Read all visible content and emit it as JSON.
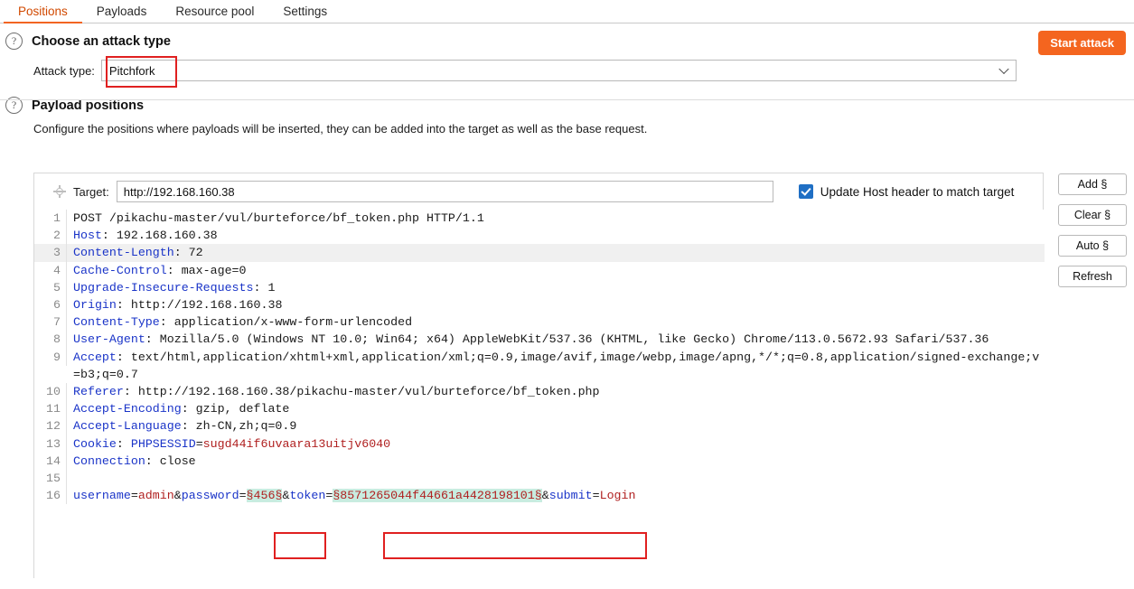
{
  "tabs": [
    {
      "label": "Positions",
      "active": true
    },
    {
      "label": "Payloads",
      "active": false
    },
    {
      "label": "Resource pool",
      "active": false
    },
    {
      "label": "Settings",
      "active": false
    }
  ],
  "start_attack_label": "Start attack",
  "attack_type_section": {
    "title": "Choose an attack type",
    "field_label": "Attack type:",
    "selected": "Pitchfork",
    "help_icon": "question-mark-icon"
  },
  "payload_positions_section": {
    "title": "Payload positions",
    "description": "Configure the positions where payloads will be inserted, they can be added into the target as well as the base request.",
    "help_icon": "question-mark-icon"
  },
  "target": {
    "icon": "crosshair-icon",
    "label": "Target:",
    "value": "http://192.168.160.38",
    "placeholder": "",
    "update_host_checkbox": {
      "label": "Update Host header to match target",
      "checked": true
    }
  },
  "side_buttons": [
    {
      "label": "Add §"
    },
    {
      "label": "Clear §"
    },
    {
      "label": "Auto §"
    },
    {
      "label": "Refresh"
    }
  ],
  "request": {
    "lines": [
      {
        "num": "1",
        "highlight": false,
        "parts": [
          {
            "text": "POST /pikachu-master/vul/burteforce/bf_token.php HTTP/1.1",
            "style": "val"
          }
        ]
      },
      {
        "num": "2",
        "highlight": false,
        "parts": [
          {
            "text": "Host",
            "style": "hdr"
          },
          {
            "text": ": 192.168.160.38",
            "style": "val"
          }
        ]
      },
      {
        "num": "3",
        "highlight": true,
        "parts": [
          {
            "text": "Content-Length",
            "style": "hdr"
          },
          {
            "text": ": 72",
            "style": "val"
          }
        ]
      },
      {
        "num": "4",
        "highlight": false,
        "parts": [
          {
            "text": "Cache-Control",
            "style": "hdr"
          },
          {
            "text": ": max-age=0",
            "style": "val"
          }
        ]
      },
      {
        "num": "5",
        "highlight": false,
        "parts": [
          {
            "text": "Upgrade-Insecure-Requests",
            "style": "hdr"
          },
          {
            "text": ": 1",
            "style": "val"
          }
        ]
      },
      {
        "num": "6",
        "highlight": false,
        "parts": [
          {
            "text": "Origin",
            "style": "hdr"
          },
          {
            "text": ": http://192.168.160.38",
            "style": "val"
          }
        ]
      },
      {
        "num": "7",
        "highlight": false,
        "parts": [
          {
            "text": "Content-Type",
            "style": "hdr"
          },
          {
            "text": ": application/x-www-form-urlencoded",
            "style": "val"
          }
        ]
      },
      {
        "num": "8",
        "highlight": false,
        "parts": [
          {
            "text": "User-Agent",
            "style": "hdr"
          },
          {
            "text": ": Mozilla/5.0 (Windows NT 10.0; Win64; x64) AppleWebKit/537.36 (KHTML, like Gecko) Chrome/113.0.5672.93 Safari/537.36",
            "style": "val"
          }
        ]
      },
      {
        "num": "9",
        "highlight": false,
        "parts": [
          {
            "text": "Accept",
            "style": "hdr"
          },
          {
            "text": ": text/html,application/xhtml+xml,application/xml;q=0.9,image/avif,image/webp,image/apng,*/*;q=0.8,application/signed-exchange;v=b3;q=0.7",
            "style": "val"
          }
        ]
      },
      {
        "num": "10",
        "highlight": false,
        "parts": [
          {
            "text": "Referer",
            "style": "hdr"
          },
          {
            "text": ": http://192.168.160.38/pikachu-master/vul/burteforce/bf_token.php",
            "style": "val"
          }
        ]
      },
      {
        "num": "11",
        "highlight": false,
        "parts": [
          {
            "text": "Accept-Encoding",
            "style": "hdr"
          },
          {
            "text": ": gzip, deflate",
            "style": "val"
          }
        ]
      },
      {
        "num": "12",
        "highlight": false,
        "parts": [
          {
            "text": "Accept-Language",
            "style": "hdr"
          },
          {
            "text": ": zh-CN,zh;q=0.9",
            "style": "val"
          }
        ]
      },
      {
        "num": "13",
        "highlight": false,
        "parts": [
          {
            "text": "Cookie",
            "style": "hdr"
          },
          {
            "text": ": ",
            "style": "val"
          },
          {
            "text": "PHPSESSID",
            "style": "blue"
          },
          {
            "text": "=",
            "style": "val"
          },
          {
            "text": "sugd44if6uvaara13uitjv6040",
            "style": "red"
          }
        ]
      },
      {
        "num": "14",
        "highlight": false,
        "parts": [
          {
            "text": "Connection",
            "style": "hdr"
          },
          {
            "text": ": close",
            "style": "val"
          }
        ]
      },
      {
        "num": "15",
        "highlight": false,
        "parts": [
          {
            "text": "",
            "style": "val"
          }
        ]
      },
      {
        "num": "16",
        "highlight": false,
        "parts": [
          {
            "text": "username",
            "style": "blue"
          },
          {
            "text": "=",
            "style": "val"
          },
          {
            "text": "admin",
            "style": "red"
          },
          {
            "text": "&",
            "style": "val"
          },
          {
            "text": "password",
            "style": "blue"
          },
          {
            "text": "=",
            "style": "val"
          },
          {
            "text": "§456§",
            "style": "mark"
          },
          {
            "text": "&",
            "style": "val"
          },
          {
            "text": "token",
            "style": "blue"
          },
          {
            "text": "=",
            "style": "val"
          },
          {
            "text": "§8571265044f44661a4428198101§",
            "style": "mark"
          },
          {
            "text": "&",
            "style": "val"
          },
          {
            "text": "submit",
            "style": "blue"
          },
          {
            "text": "=",
            "style": "val"
          },
          {
            "text": "Login",
            "style": "red"
          }
        ]
      }
    ]
  },
  "highlight_boxes": [
    {
      "name": "attack-type-highlight"
    },
    {
      "name": "password-payload-highlight"
    },
    {
      "name": "token-payload-highlight"
    }
  ],
  "colors": {
    "accent_orange": "#f26522",
    "start_attack_bg": "#f4651f",
    "header_blue": "#1a34c8",
    "value_red": "#b02020",
    "payload_marker_bg": "#c8ece0",
    "highlight_box_border": "#e02020",
    "checkbox_blue": "#1f6fc4"
  }
}
